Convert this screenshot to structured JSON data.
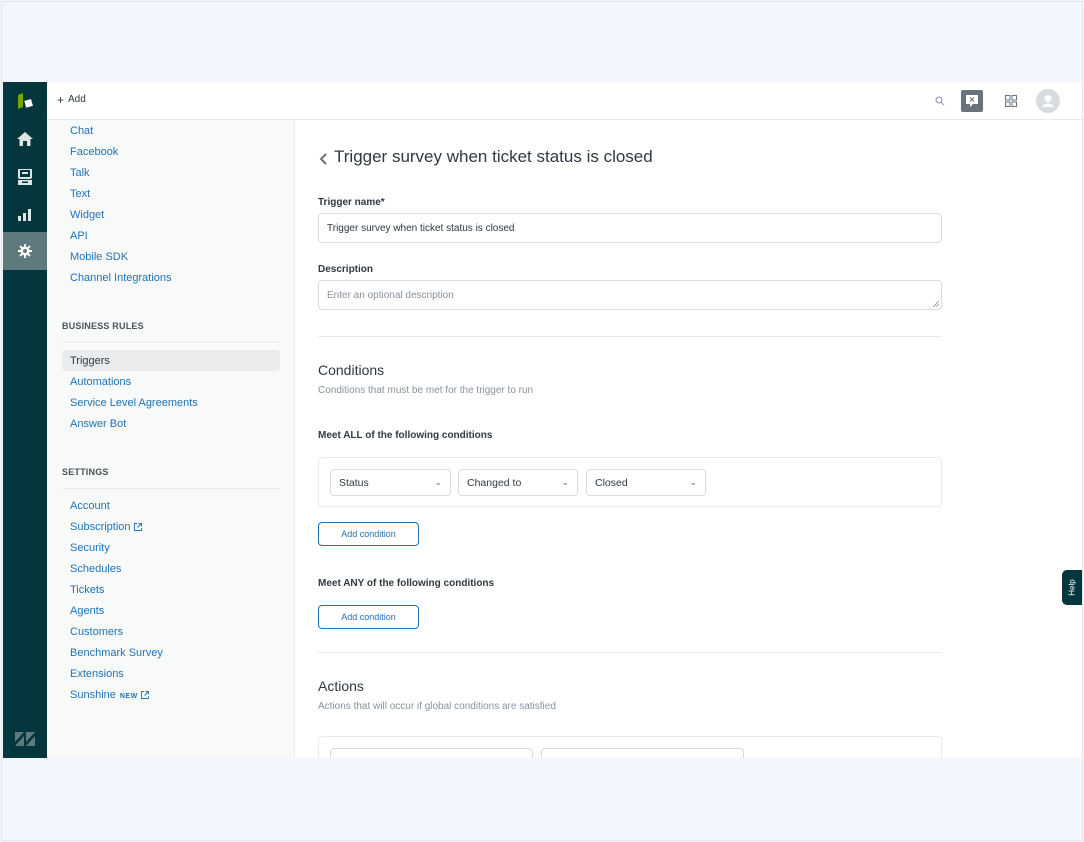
{
  "topbar": {
    "add_label": "Add",
    "icons": [
      "search-icon",
      "chat-icon",
      "apps-grid-icon",
      "avatar-icon"
    ]
  },
  "nav": {
    "items": [
      "logo-icon",
      "home-icon",
      "views-icon",
      "reporting-icon",
      "admin-icon"
    ],
    "active": "admin-icon",
    "footer": "zendesk-logo-icon"
  },
  "sidebar": {
    "channels": [
      "Chat",
      "Facebook",
      "Talk",
      "Text",
      "Widget",
      "API",
      "Mobile SDK",
      "Channel Integrations"
    ],
    "business_rules_heading": "BUSINESS RULES",
    "business_rules": [
      "Triggers",
      "Automations",
      "Service Level Agreements",
      "Answer Bot"
    ],
    "active_item": "Triggers",
    "settings_heading": "SETTINGS",
    "settings": [
      "Account",
      "Subscription",
      "Security",
      "Schedules",
      "Tickets",
      "Agents",
      "Customers",
      "Benchmark Survey",
      "Extensions",
      "Sunshine"
    ],
    "new_badge": "NEW"
  },
  "main": {
    "title": "Trigger survey when ticket status is closed",
    "trigger_name_label": "Trigger name*",
    "trigger_name_value": "Trigger survey when ticket status is closed",
    "description_label": "Description",
    "description_placeholder": "Enter an optional description",
    "conditions": {
      "heading": "Conditions",
      "subtitle": "Conditions that must be met for the trigger to run",
      "all_label": "Meet ALL of the following conditions",
      "all_rows": [
        {
          "field": "Status",
          "operator": "Changed to",
          "value": "Closed"
        }
      ],
      "add_button": "Add condition",
      "any_label": "Meet ANY of the following conditions",
      "any_add_button": "Add condition"
    },
    "actions": {
      "heading": "Actions",
      "subtitle": "Actions that will occur if global conditions are satisfied"
    }
  },
  "help_tab": "Help",
  "colors": {
    "nav_bg": "#03363d",
    "link": "#1f73b7",
    "logo_green": "#78a300"
  }
}
